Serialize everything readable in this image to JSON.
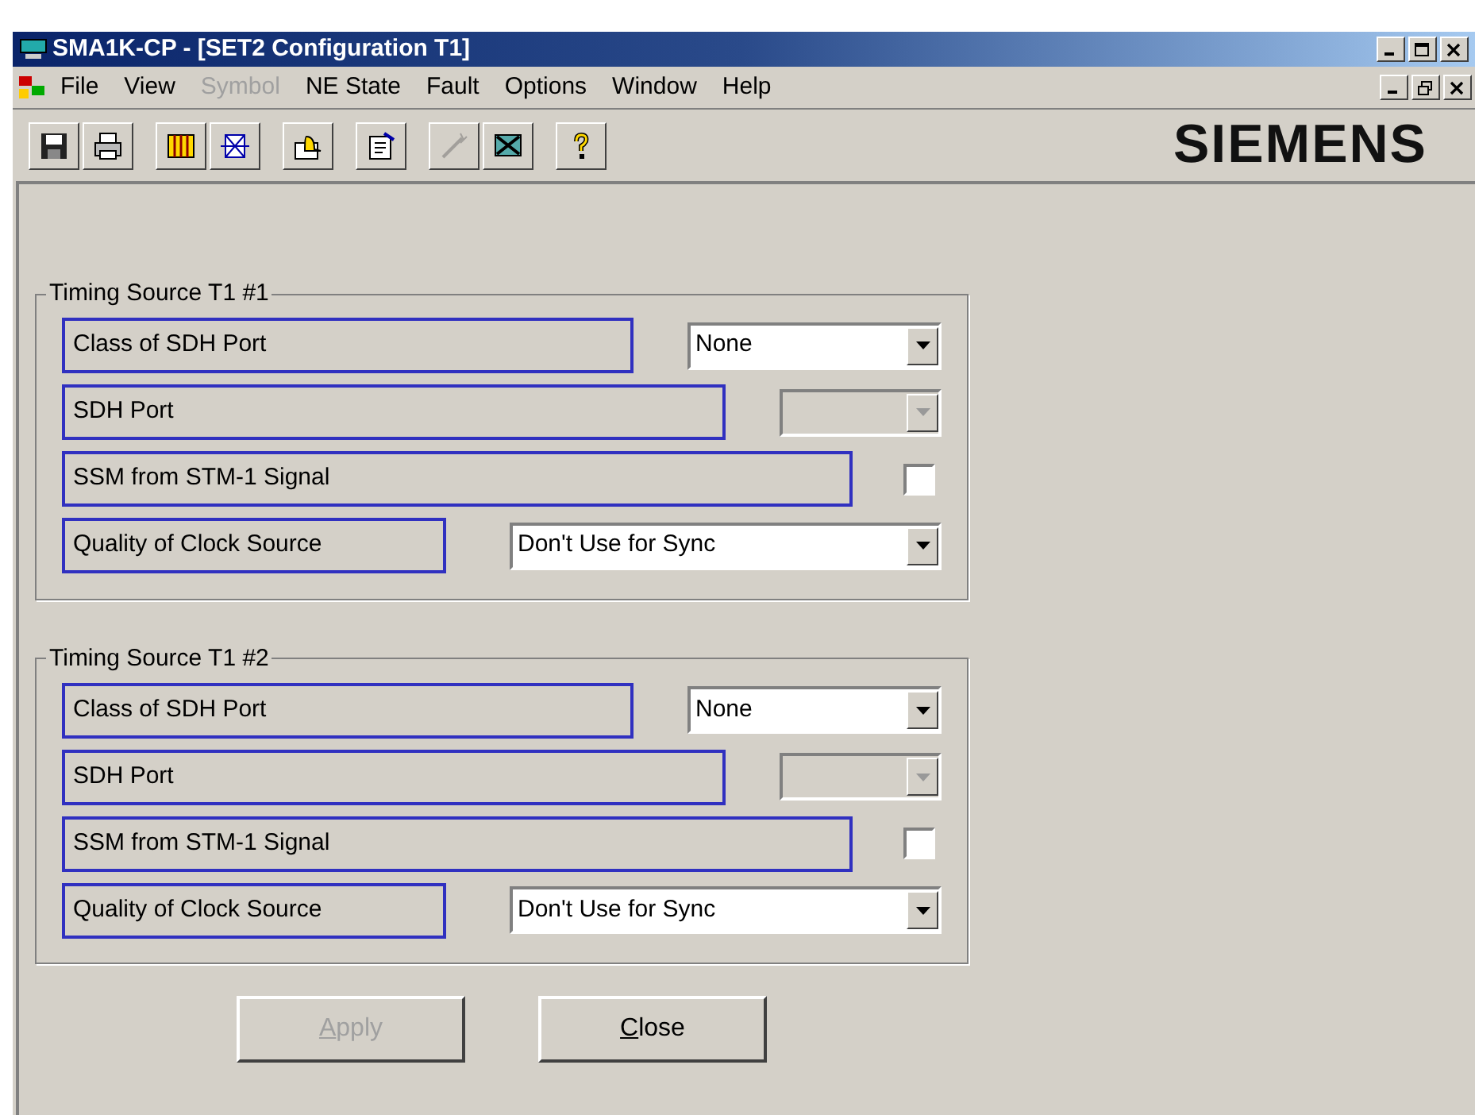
{
  "window": {
    "title": "SMA1K-CP - [SET2 Configuration T1]"
  },
  "menu": [
    {
      "label": "File",
      "disabled": false
    },
    {
      "label": "View",
      "disabled": false
    },
    {
      "label": "Symbol",
      "disabled": true
    },
    {
      "label": "NE State",
      "disabled": false
    },
    {
      "label": "Fault",
      "disabled": false
    },
    {
      "label": "Options",
      "disabled": false
    },
    {
      "label": "Window",
      "disabled": false
    },
    {
      "label": "Help",
      "disabled": false
    }
  ],
  "toolbar": {
    "groups": [
      [
        {
          "kind": "save",
          "disabled": false
        },
        {
          "kind": "print",
          "disabled": false
        }
      ],
      [
        {
          "kind": "grid",
          "disabled": false
        },
        {
          "kind": "crossbox",
          "disabled": false
        }
      ],
      [
        {
          "kind": "alarm",
          "disabled": false
        }
      ],
      [
        {
          "kind": "properties",
          "disabled": false
        }
      ],
      [
        {
          "kind": "wand",
          "disabled": true
        },
        {
          "kind": "disconnect",
          "disabled": false
        }
      ],
      [
        {
          "kind": "help",
          "disabled": false
        }
      ]
    ],
    "logo": "SIEMENS"
  },
  "groups": [
    {
      "title": "Timing Source T1 #1",
      "rows": [
        {
          "kind": "select",
          "label": "Class of SDH Port",
          "value": "None",
          "disabled": false
        },
        {
          "kind": "select",
          "label": "SDH Port",
          "value": "",
          "disabled": true
        },
        {
          "kind": "checkbox",
          "label": "SSM from STM-1 Signal",
          "checked": false
        },
        {
          "kind": "select",
          "label": "Quality of Clock Source",
          "value": "Don't Use for Sync",
          "disabled": false
        }
      ]
    },
    {
      "title": "Timing Source T1 #2",
      "rows": [
        {
          "kind": "select",
          "label": "Class of SDH Port",
          "value": "None",
          "disabled": false
        },
        {
          "kind": "select",
          "label": "SDH Port",
          "value": "",
          "disabled": true
        },
        {
          "kind": "checkbox",
          "label": "SSM from STM-1 Signal",
          "checked": false
        },
        {
          "kind": "select",
          "label": "Quality of Clock Source",
          "value": "Don't Use for Sync",
          "disabled": false
        }
      ]
    }
  ],
  "buttons": [
    {
      "label": "Apply",
      "disabled": true
    },
    {
      "label": "Close",
      "disabled": false
    }
  ]
}
